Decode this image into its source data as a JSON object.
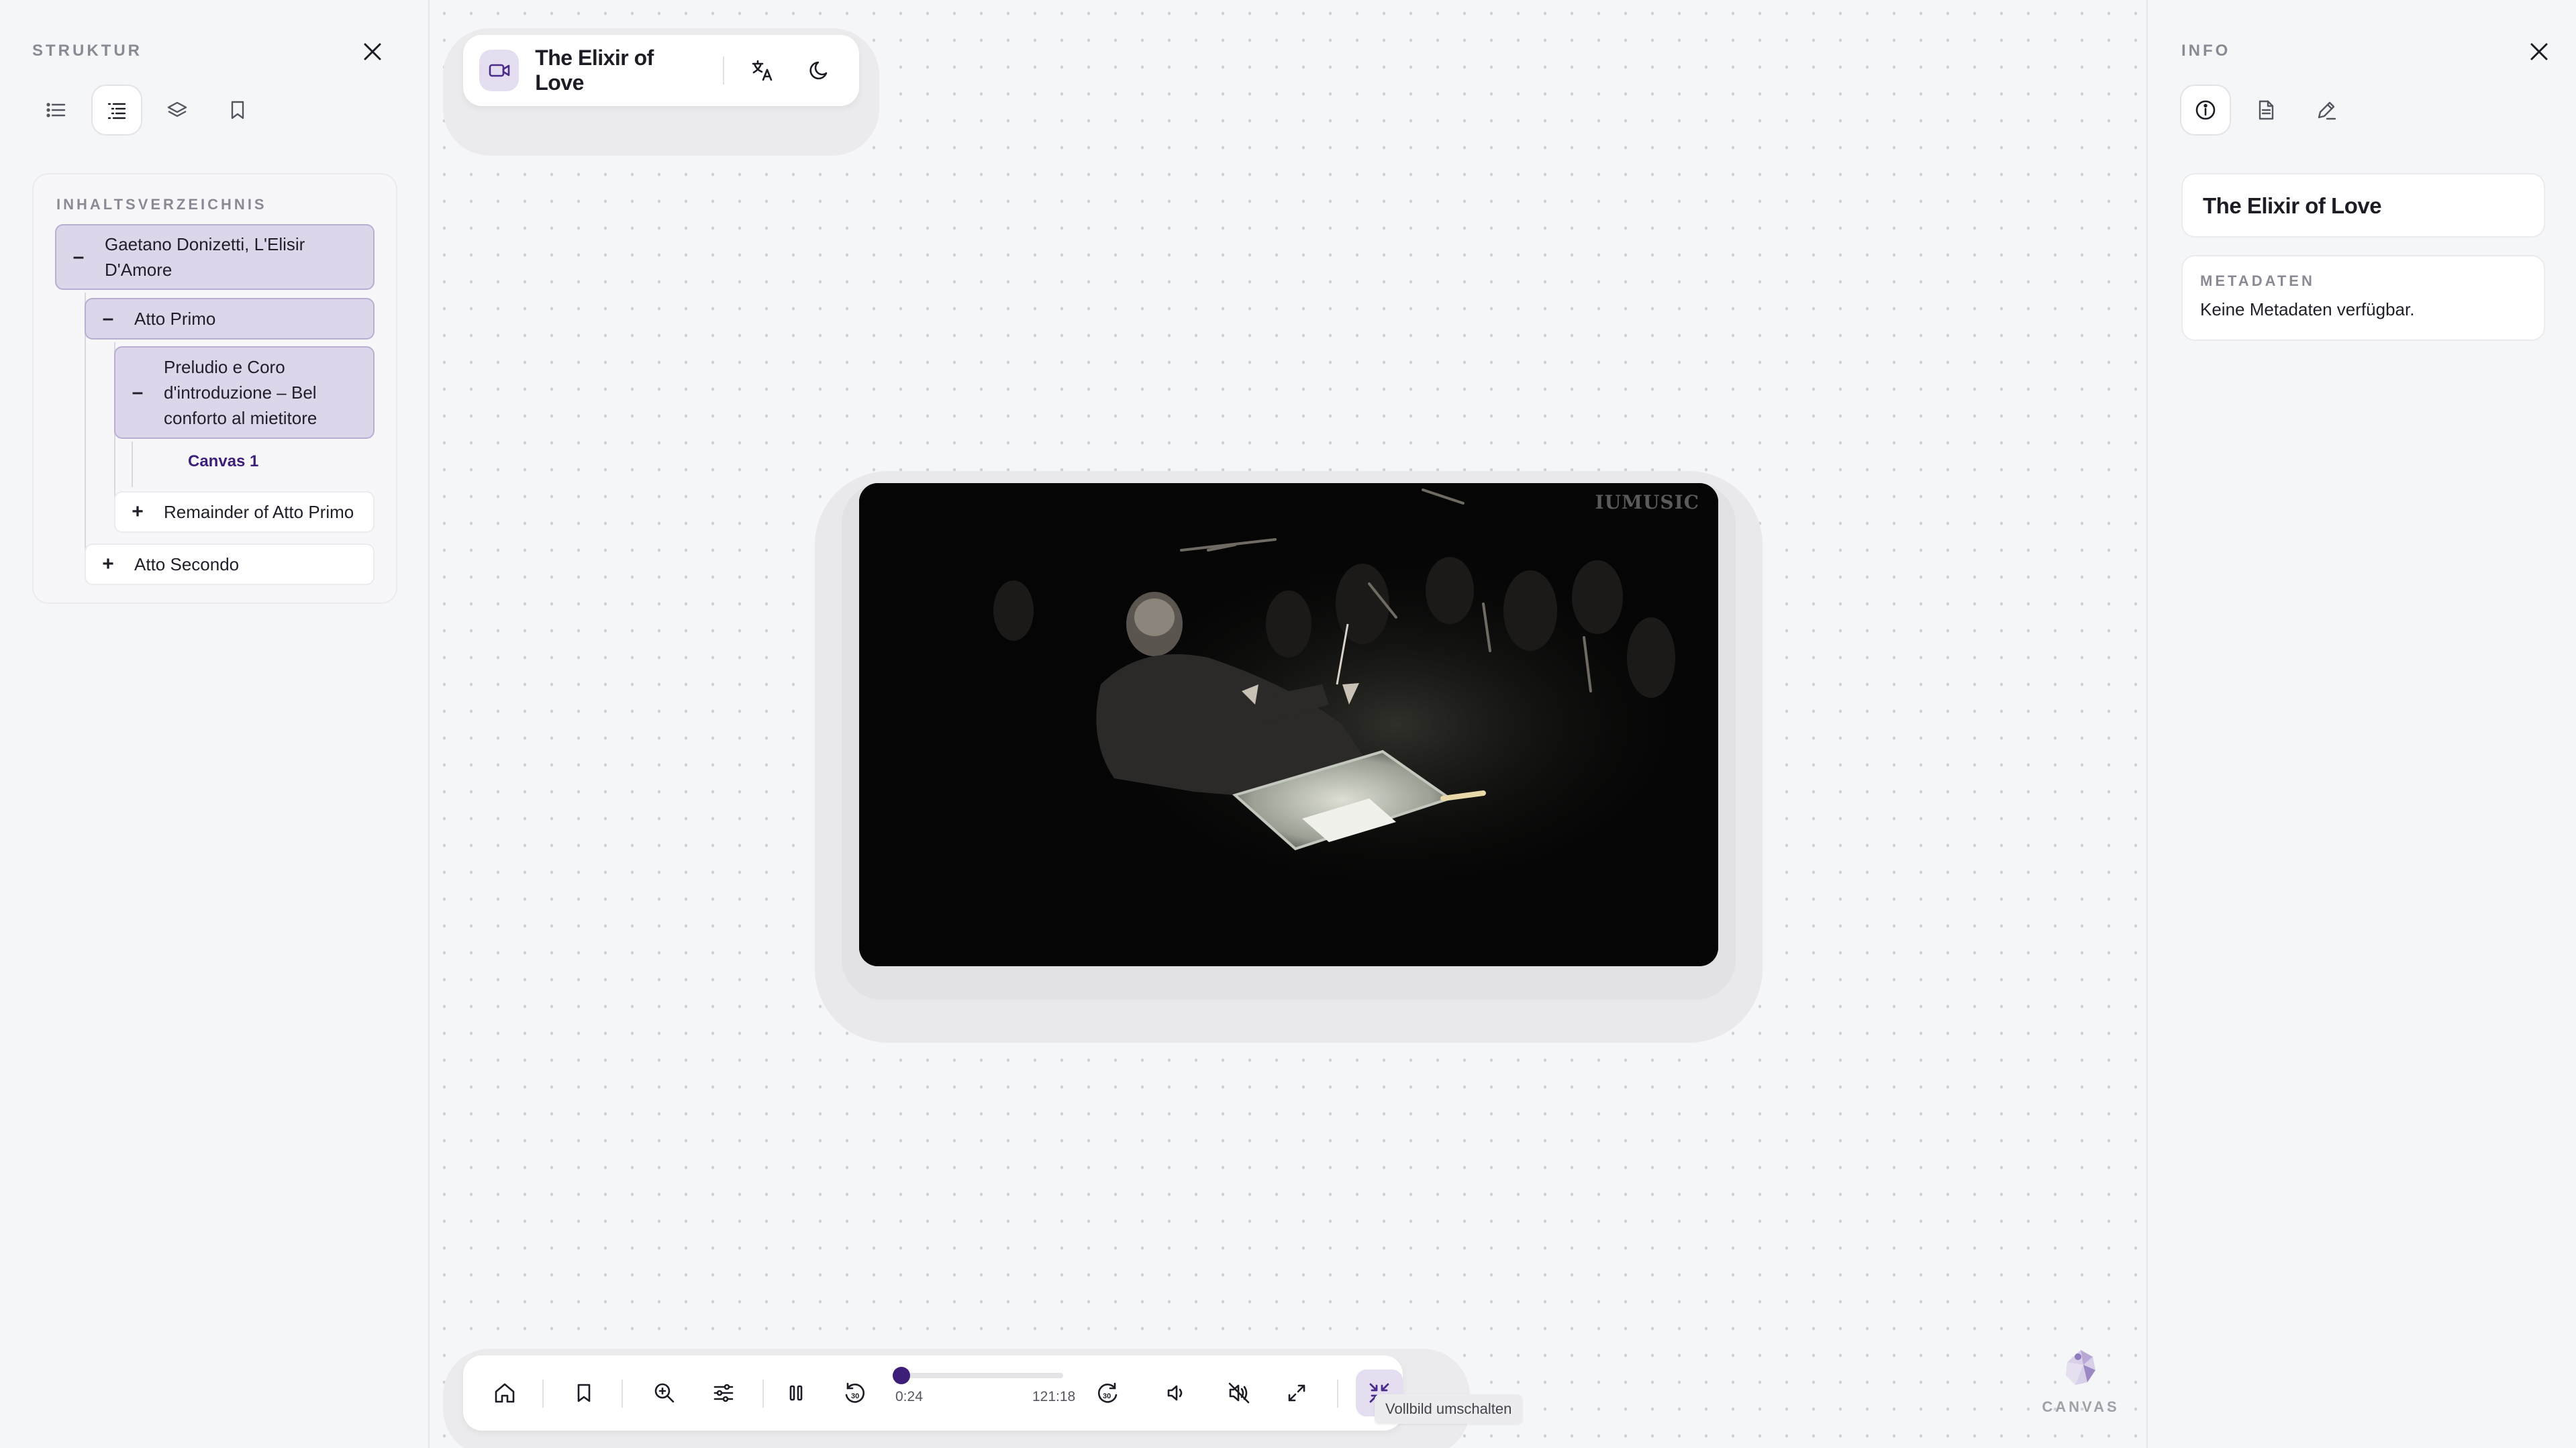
{
  "left_panel": {
    "title": "STRUKTUR",
    "close_icon": "close-icon",
    "view_icons": [
      "list-icon",
      "tree-list-icon",
      "layers-icon",
      "bookmark-icon"
    ],
    "toc_heading": "INHALTSVERZEICHNIS",
    "toc": {
      "root_label": "Gaetano Donizetti, L'Elisir D'Amore",
      "atto_primo": "Atto Primo",
      "preludio": "Preludio e Coro d'introduzione – Bel conforto al mietitore",
      "canvas": "Canvas 1",
      "remainder": "Remainder of Atto Primo",
      "atto_secondo": "Atto Secondo",
      "collapse_sign": "–",
      "expand_sign": "+"
    }
  },
  "topbar": {
    "title": "The Elixir of Love",
    "icons": [
      "video-icon",
      "translate-icon",
      "moon-icon"
    ]
  },
  "video": {
    "watermark": "IUMUSIC"
  },
  "controls": {
    "current_time": "0:24",
    "duration": "121:18",
    "progress": 0.0033,
    "tooltip": "Vollbild umschalten",
    "icons": [
      "home-icon",
      "bookmark-icon",
      "zoom-in-icon",
      "sliders-icon",
      "pause-icon",
      "rewind-30-icon",
      "forward-30-icon",
      "volume-icon",
      "mute-icon",
      "fullscreen-icon",
      "exit-fullscreen-icon"
    ],
    "skip_seconds": "30"
  },
  "brand": {
    "label": "CANVAS"
  },
  "right_panel": {
    "title": "INFO",
    "close_icon": "close-icon",
    "tab_icons": [
      "info-icon",
      "document-icon",
      "pen-icon"
    ],
    "item_title": "The Elixir of Love",
    "meta_heading": "METADATEN",
    "meta_text": "Keine Metadaten verfügbar."
  },
  "colors": {
    "accent": "#3d1f7a",
    "accent_light": "#e5def0",
    "toc_open_bg": "#ddd6ea",
    "background": "#f5f6f8"
  }
}
